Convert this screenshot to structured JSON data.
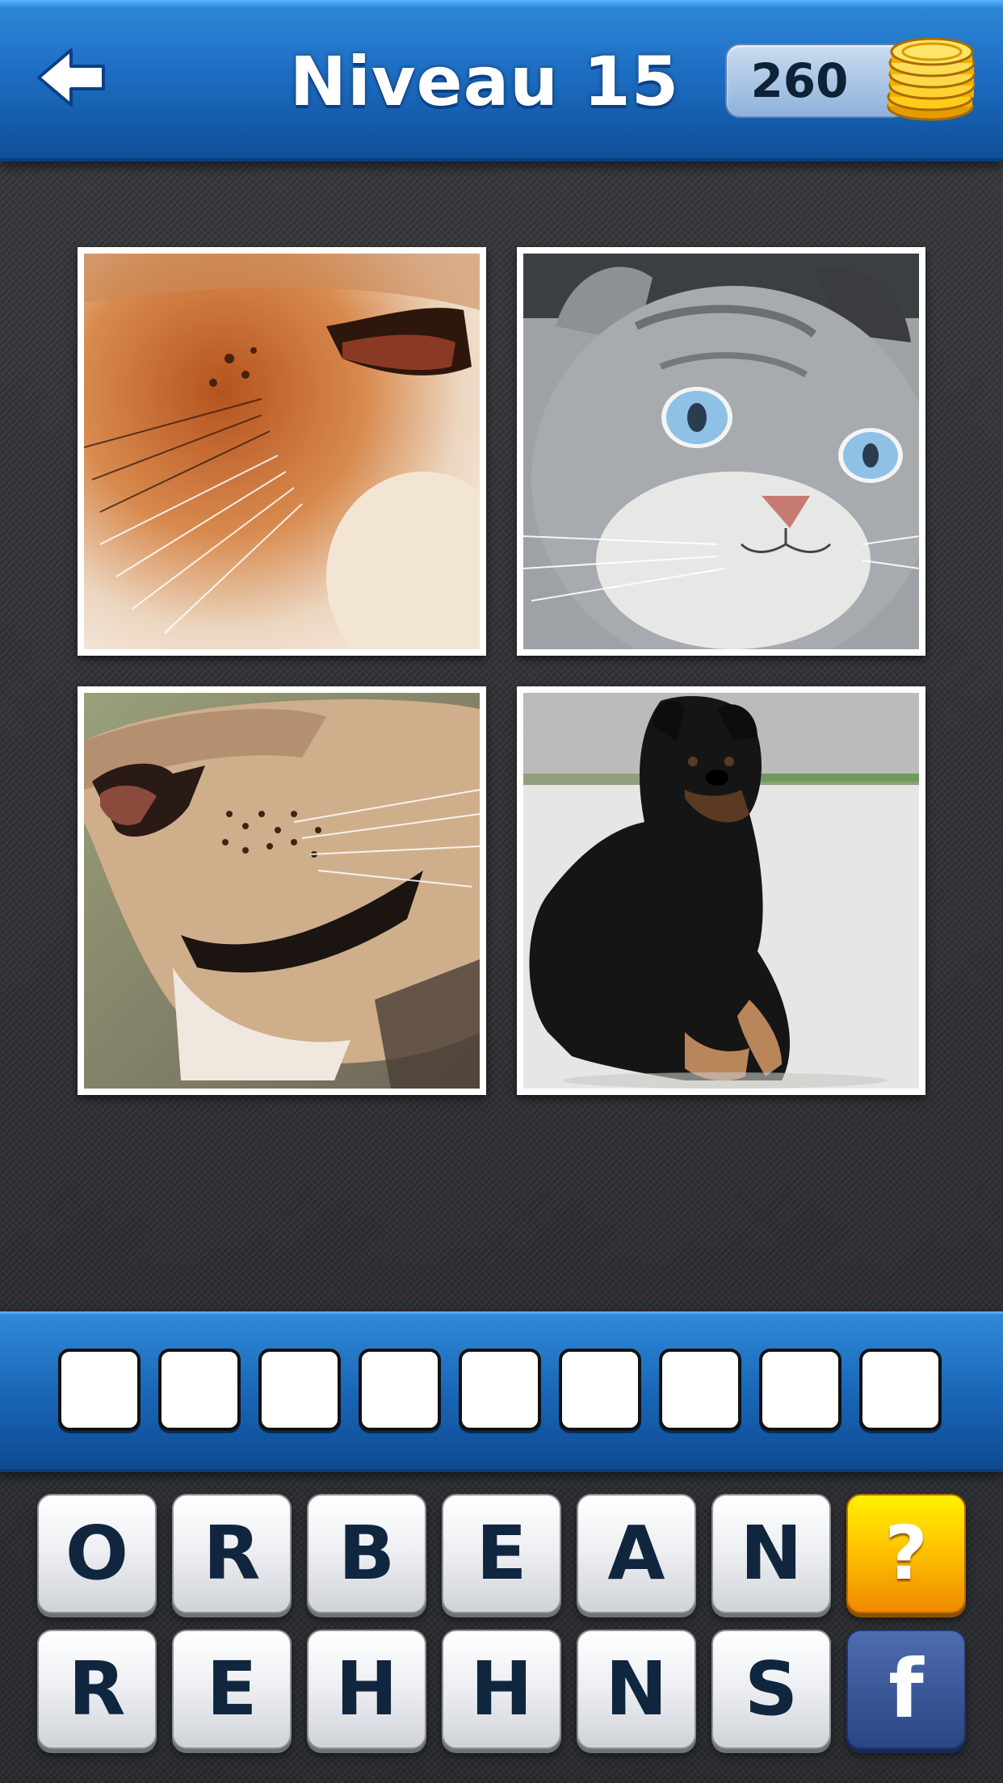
{
  "header": {
    "back_icon": "back-arrow-icon",
    "level_title": "Niveau 15",
    "coins": "260",
    "coins_icon": "gold-coins-stack-icon"
  },
  "puzzle": {
    "photos": [
      {
        "name": "photo-fox-snout-closeup",
        "subject": "fox-snout"
      },
      {
        "name": "photo-grey-cat-face",
        "subject": "grey-cat"
      },
      {
        "name": "photo-lion-muzzle-closeup",
        "subject": "lion-muzzle"
      },
      {
        "name": "photo-black-dog-lying",
        "subject": "black-dog"
      }
    ]
  },
  "answer": {
    "slot_count": 9,
    "slots": [
      "",
      "",
      "",
      "",
      "",
      "",
      "",
      "",
      ""
    ]
  },
  "keyboard": {
    "row1": [
      "O",
      "R",
      "B",
      "E",
      "A",
      "N"
    ],
    "row2": [
      "R",
      "E",
      "H",
      "H",
      "N",
      "S"
    ],
    "help_label": "?",
    "facebook_label": "f"
  },
  "colors": {
    "bar_blue": "#1d6ec3",
    "key_text": "#10263f",
    "help_yellow": "#ffc400",
    "facebook_blue": "#3b5998"
  }
}
